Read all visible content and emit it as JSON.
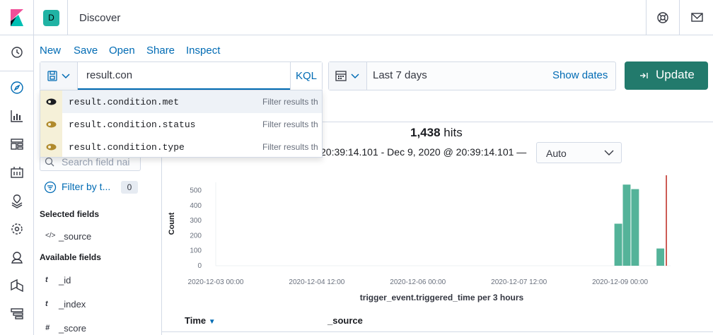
{
  "header": {
    "app_title": "Discover",
    "space_initial": "D",
    "space_color": "#20b3a4"
  },
  "left_nav": {
    "icons": [
      "recent-icon",
      "discover-icon",
      "visualize-icon",
      "dashboard-icon",
      "canvas-icon",
      "maps-icon",
      "ml-icon",
      "uptime-icon",
      "apm-icon",
      "logs-icon"
    ]
  },
  "toolbar": {
    "new_label": "New",
    "save_label": "Save",
    "open_label": "Open",
    "share_label": "Share",
    "inspect_label": "Inspect"
  },
  "query": {
    "value": "result.con",
    "language": "KQL"
  },
  "date_picker": {
    "range_label": "Last 7 days",
    "show_dates_label": "Show dates"
  },
  "update_button": {
    "label": "Update",
    "color": "#227a6c"
  },
  "suggestions": [
    {
      "field": "result.condition.met",
      "description": "Filter results th"
    },
    {
      "field": "result.condition.status",
      "description": "Filter results th"
    },
    {
      "field": "result.condition.type",
      "description": "Filter results th"
    }
  ],
  "sidebar": {
    "search_placeholder": "Search field nai",
    "filter_label": "Filter by t...",
    "filter_count": "0",
    "selected_heading": "Selected fields",
    "selected_fields": [
      {
        "type": "</>",
        "name": "_source"
      }
    ],
    "available_heading": "Available fields",
    "available_fields": [
      {
        "type": "t",
        "name": "_id"
      },
      {
        "type": "t",
        "name": "_index"
      },
      {
        "type": "#",
        "name": "_score"
      }
    ]
  },
  "results": {
    "hits_count": "1,438",
    "hits_label": "hits",
    "time_range": "20:39:14.101 - Dec 9, 2020 @ 20:39:14.101 —",
    "interval_value": "Auto"
  },
  "chart_data": {
    "type": "bar",
    "xlabel": "trigger_event.triggered_time per 3 hours",
    "ylabel": "Count",
    "ylim": [
      0,
      550
    ],
    "yticks": [
      0,
      100,
      200,
      300,
      400,
      500
    ],
    "x_tick_labels": [
      "2020-12-03 00:00",
      "2020-12-04 12:00",
      "2020-12-06 00:00",
      "2020-12-07 12:00",
      "2020-12-09 00:00"
    ],
    "x_tick_hours": [
      0,
      36,
      72,
      108,
      144
    ],
    "x_range_hours": [
      0,
      162
    ],
    "bar_width_hours": 3,
    "bars": [
      {
        "start_hour": 142,
        "value": 275
      },
      {
        "start_hour": 145,
        "value": 535
      },
      {
        "start_hour": 148,
        "value": 505
      },
      {
        "start_hour": 157,
        "value": 110
      }
    ],
    "now_marker_hour": 160.5,
    "bar_color": "#54b399",
    "marker_color": "#bd271e",
    "grid": false
  },
  "table": {
    "time_header": "Time",
    "source_header": "_source"
  }
}
